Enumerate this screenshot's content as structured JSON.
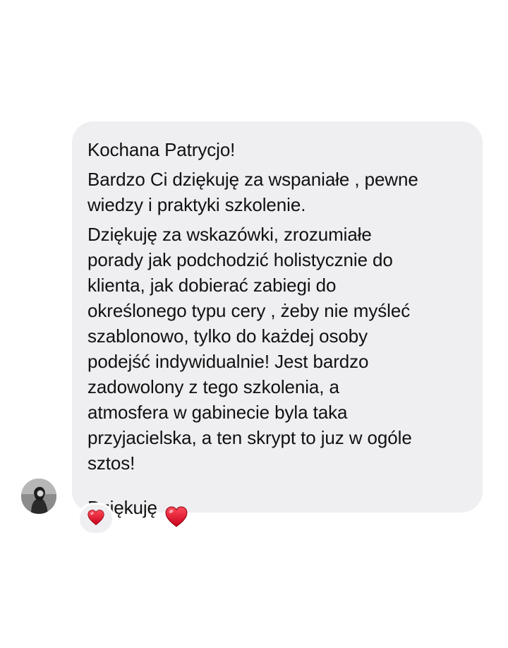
{
  "message": {
    "paragraphs": [
      "Kochana Patrycjo!",
      "Bardzo Ci dziękuję za wspaniałe , pewne\nwiedzy i praktyki szkolenie.",
      "Dziękuję za wskazówki, zrozumiałe\nporady jak podchodzić holistycznie do\nklienta, jak dobierać zabiegi do\nokreślonego typu cery , żeby nie myśleć\nszablonowo, tylko do każdej osoby\npodejść indywidualnie! Jest bardzo\nzadowolony z tego szkolenia, a\natmosfera w gabinecie byla taka\nprzyjacielska, a ten skrypt to juz w ogóle\nsztos!"
    ],
    "closing": "Dziękuję",
    "closing_icon": "red-heart-icon",
    "bubble_color": "#efeff2"
  },
  "sender": {
    "avatar_icon": "profile-photo"
  },
  "reaction": {
    "icon": "red-heart-icon",
    "heart_color": "#e0142b"
  }
}
